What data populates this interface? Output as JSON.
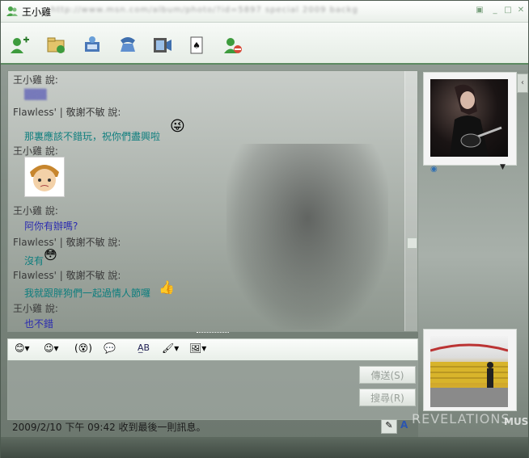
{
  "window": {
    "title": "王小雞",
    "subtitle_blurred": "http://www.msn.com/album/photo/?id=5897 special 2009 background"
  },
  "toolbar": {
    "buttons": [
      {
        "name": "invite-contact",
        "icon": "add-contact-icon"
      },
      {
        "name": "send-files",
        "icon": "folder-send-icon"
      },
      {
        "name": "video-call",
        "icon": "webcam-icon"
      },
      {
        "name": "voice-call",
        "icon": "phone-icon"
      },
      {
        "name": "activities",
        "icon": "film-icon"
      },
      {
        "name": "games",
        "icon": "card-game-icon"
      },
      {
        "name": "block",
        "icon": "block-contact-icon"
      }
    ]
  },
  "conversation": {
    "messages": [
      {
        "sender": "王小雞 說:",
        "text": "▒▒▒",
        "style": "blue"
      },
      {
        "sender": "Flawless' | 敬謝不敏 說:",
        "text": "那裏應該不錯玩，祝你們盡興啦",
        "style": "teal"
      },
      {
        "sender": "王小雞 說:",
        "text": "",
        "style": "blue"
      },
      {
        "sender": "王小雞 說:",
        "text": "阿你有辦嗎?",
        "style": "blue"
      },
      {
        "sender": "Flawless' | 敬謝不敏 說:",
        "text": "沒有",
        "style": "teal"
      },
      {
        "sender": "Flawless' | 敬謝不敏 說:",
        "text": "我就跟胖狗們一起過情人節囉",
        "style": "teal"
      },
      {
        "sender": "王小雞 說:",
        "text": "也不錯",
        "style": "blue"
      }
    ]
  },
  "format_bar": {
    "items": [
      "emoticon-icon",
      "wink-icon",
      "nudge-icon",
      "voice-clip-icon",
      "font-icon",
      "background-icon",
      "handwriting-icon"
    ]
  },
  "input": {
    "placeholder": "",
    "value": ""
  },
  "buttons": {
    "send_label": "傳送(S)",
    "search_label": "搜尋(R)"
  },
  "status": {
    "last_message": "2009/2/10 下午 09:42 收到最後一則訊息。"
  },
  "decor": {
    "revelations": "REVELATIONS",
    "muse": "MUS"
  },
  "colors": {
    "accent": "#5b8a60",
    "teal_text": "#0e7e7e",
    "blue_text": "#2b2bb0"
  }
}
